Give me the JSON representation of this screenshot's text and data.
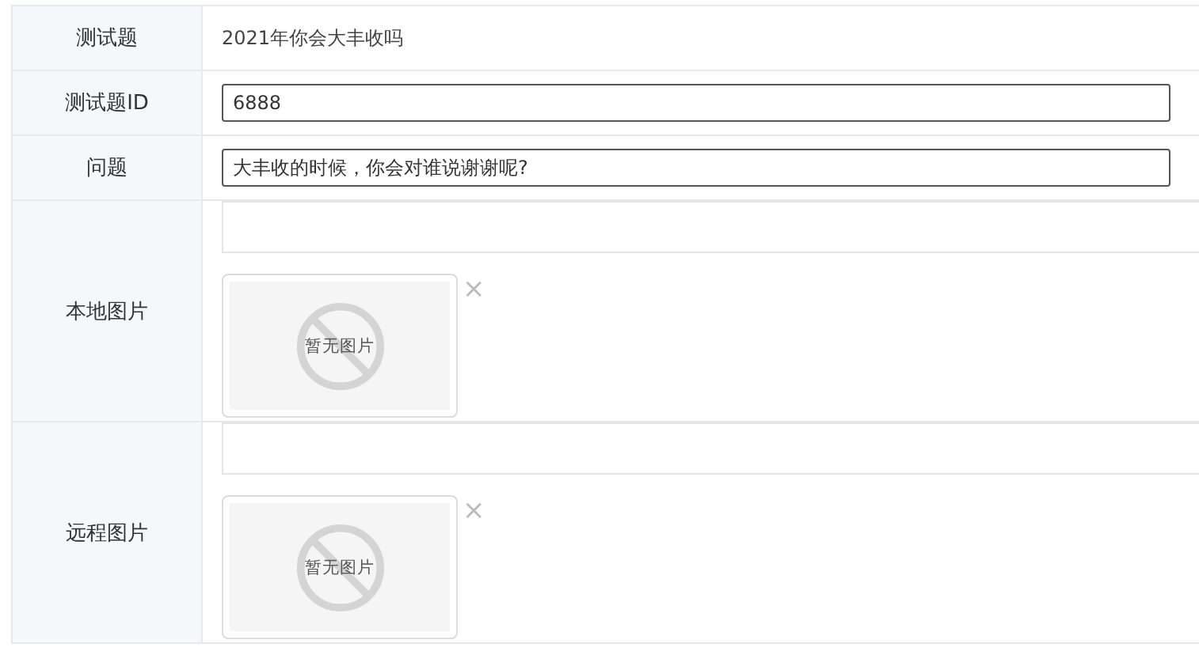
{
  "rows": [
    {
      "kind": "text",
      "label": "测试题",
      "value": "2021年你会大丰收吗"
    },
    {
      "kind": "input",
      "label": "测试题ID",
      "value": "6888"
    },
    {
      "kind": "input",
      "label": "问题",
      "value": "大丰收的时候，你会对谁说谢谢呢?"
    },
    {
      "kind": "image",
      "label": "本地图片",
      "empty_text": "暂无图片",
      "remove": "×"
    },
    {
      "kind": "image",
      "label": "远程图片",
      "empty_text": "暂无图片",
      "remove": "×"
    }
  ]
}
